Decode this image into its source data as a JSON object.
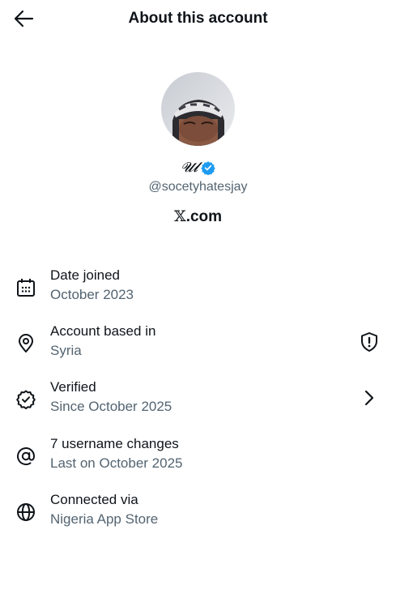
{
  "header": {
    "title": "About this account",
    "back_icon": "arrow-left-icon"
  },
  "profile": {
    "display_name": "𝓤𝓵",
    "verified_icon": "verified-badge-icon",
    "verified_color": "#1d9bf0",
    "handle": "@socetyhatesjay",
    "site_x": "𝕏",
    "site_rest": ".com"
  },
  "rows": [
    {
      "label": "Date joined",
      "value": "October 2023",
      "icon": "calendar-icon"
    },
    {
      "label": "Account based in",
      "value": "Syria",
      "icon": "location-pin-icon",
      "trailing_icon": "shield-alert-icon"
    },
    {
      "label": "Verified",
      "value": "Since October 2025",
      "icon": "verified-check-icon",
      "trailing_icon": "chevron-right-icon"
    },
    {
      "label": "7 username changes",
      "value": "Last on October 2025",
      "icon": "at-sign-icon"
    },
    {
      "label": "Connected via",
      "value": "Nigeria App Store",
      "icon": "globe-icon"
    }
  ],
  "colors": {
    "text_primary": "#0f1419",
    "text_secondary": "#536471",
    "accent": "#1d9bf0"
  }
}
